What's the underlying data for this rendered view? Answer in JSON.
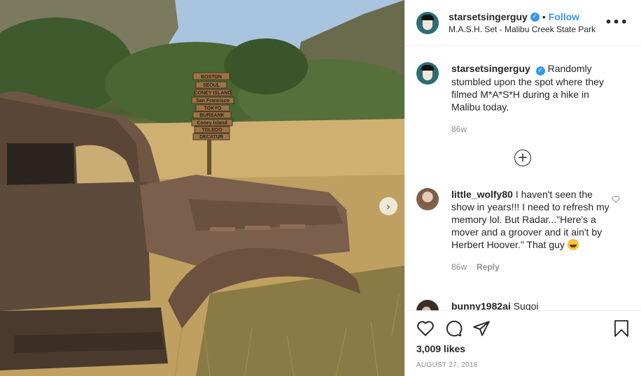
{
  "post": {
    "username": "starsetsingerguy",
    "location": "M.A.S.H. Set - Malibu Creek State Park",
    "follow_label": "Follow",
    "dot": "•",
    "more_label": "•••",
    "caption": "Randomly stumbled upon the spot where they filmed M*A*S*H during a hike in Malibu today.",
    "caption_age": "86w",
    "likes": "3,009 likes",
    "date": "AUGUST 27, 2018"
  },
  "signs": [
    "BOSTON",
    "SEOUL",
    "CONEY ISLAND",
    "San Francisco",
    "TOKYO",
    "BURBANK",
    "Coney Island",
    "TOLEDO",
    "DECATUR"
  ],
  "comments": [
    {
      "username": "little_wolfy80",
      "text": "I haven't seen the show in years!!! I need to refresh my memory lol. But Radar...\"Here's a mover and a groover and it ain't by Herbert Hoover.\" That guy",
      "age": "86w",
      "reply_label": "Reply"
    },
    {
      "username": "bunny1982ai",
      "text": "Sugoi"
    }
  ],
  "colors": {
    "accent": "#3897f0",
    "text": "#262626",
    "muted": "#8e8e8e",
    "border": "#efefef"
  },
  "icons": [
    "heart-icon",
    "comment-icon",
    "share-icon",
    "bookmark-icon",
    "add-circle-icon",
    "chevron-right-icon",
    "more-icon",
    "verified-icon"
  ]
}
